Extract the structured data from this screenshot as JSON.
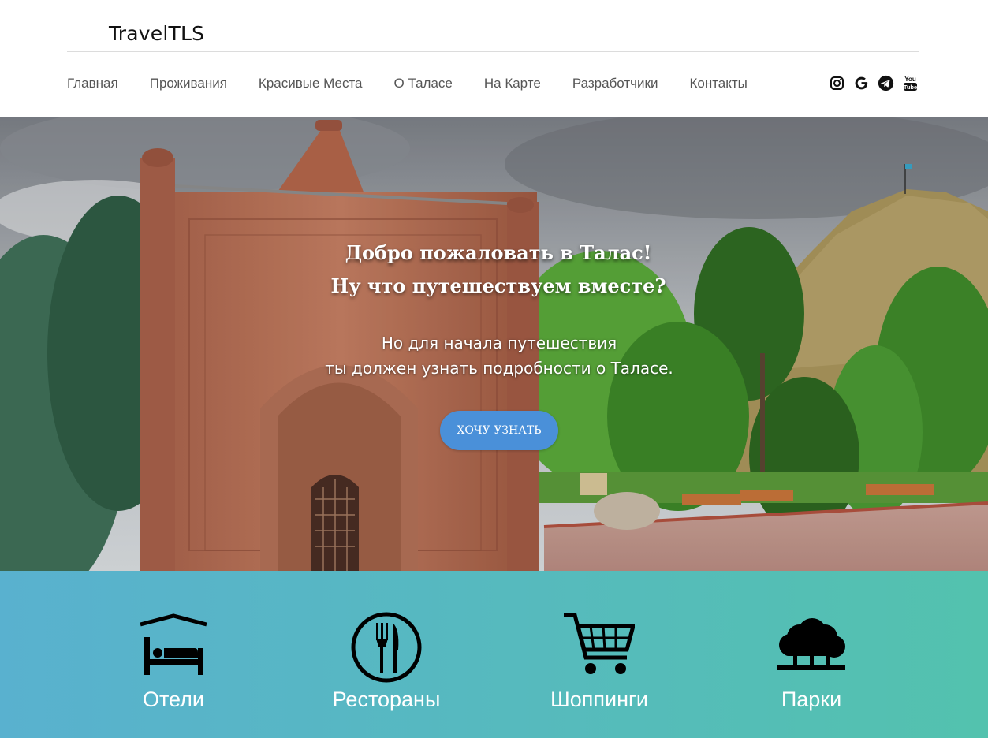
{
  "header": {
    "logo": "TravelTLS",
    "nav": [
      "Главная",
      "Проживания",
      "Красивые Места",
      "О Таласе",
      "На Карте",
      "Разработчики",
      "Контакты"
    ],
    "social": [
      "instagram-icon",
      "google-icon",
      "telegram-icon",
      "youtube-icon"
    ]
  },
  "hero": {
    "title_line1": "Добро пожаловать в Талас!",
    "title_line2": "Ну что путешествуем вместе?",
    "subtitle_line1": "Но для начала путешествия",
    "subtitle_line2": "ты должен узнать подробности о Таласе.",
    "cta": "ХОЧУ УЗНАТЬ"
  },
  "categories": [
    {
      "label": "Отели",
      "icon": "hotel-bed-icon"
    },
    {
      "label": "Рестораны",
      "icon": "fork-knife-icon"
    },
    {
      "label": "Шоппинги",
      "icon": "shopping-cart-icon"
    },
    {
      "label": "Парки",
      "icon": "trees-icon"
    }
  ],
  "colors": {
    "cta": "#4a90d9",
    "gradient_start": "#59b1cf",
    "gradient_end": "#53c2ae"
  }
}
